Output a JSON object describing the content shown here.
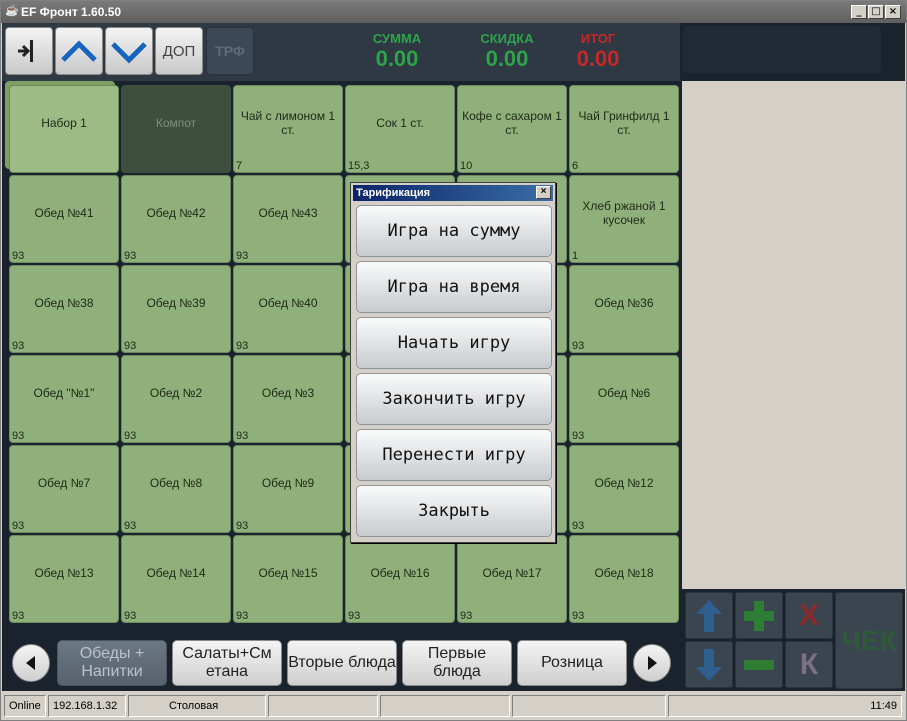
{
  "window": {
    "title": "EF Фронт 1.60.50",
    "controls": [
      "_",
      "□",
      "×"
    ]
  },
  "toolbar": {
    "dop_label": "ДОП",
    "trf_label": "ТРФ",
    "totals": [
      {
        "label": "СУММА",
        "value": "0.00",
        "color": "#2ea34a"
      },
      {
        "label": "СКИДКА",
        "value": "0.00",
        "color": "#2ea34a"
      },
      {
        "label": "ИТОГ",
        "value": "0.00",
        "color": "#c62828"
      }
    ]
  },
  "tiles": [
    [
      "Набор 1",
      ""
    ],
    [
      "Компот",
      ""
    ],
    [
      "Чай с лимоном 1 ст.",
      "7"
    ],
    [
      "Сок 1 ст.",
      "15,3"
    ],
    [
      "Кофе с сахаром 1 ст.",
      "10"
    ],
    [
      "Чай Гринфилд 1 ст.",
      "6"
    ],
    [
      "Обед №41",
      "93"
    ],
    [
      "Обед №42",
      "93"
    ],
    [
      "Обед №43",
      "93"
    ],
    [
      "",
      ""
    ],
    [
      "",
      ""
    ],
    [
      "Хлеб ржаной 1 кусочек",
      "1"
    ],
    [
      "Обед №38",
      "93"
    ],
    [
      "Обед №39",
      "93"
    ],
    [
      "Обед №40",
      "93"
    ],
    [
      "",
      ""
    ],
    [
      "",
      ""
    ],
    [
      "Обед №36",
      "93"
    ],
    [
      "Обед \"№1\"",
      "93"
    ],
    [
      "Обед №2",
      "93"
    ],
    [
      "Обед №3",
      "93"
    ],
    [
      "",
      ""
    ],
    [
      "",
      ""
    ],
    [
      "Обед №6",
      "93"
    ],
    [
      "Обед №7",
      "93"
    ],
    [
      "Обед №8",
      "93"
    ],
    [
      "Обед №9",
      "93"
    ],
    [
      "",
      ""
    ],
    [
      "",
      ""
    ],
    [
      "Обед №12",
      "93"
    ],
    [
      "Обед №13",
      "93"
    ],
    [
      "Обед №14",
      "93"
    ],
    [
      "Обед №15",
      "93"
    ],
    [
      "Обед №16",
      "93"
    ],
    [
      "Обед №17",
      "93"
    ],
    [
      "Обед №18",
      "93"
    ]
  ],
  "categories": [
    "Обеды + Напитки",
    "Салаты+См етана",
    "Вторые блюда",
    "Первые блюда",
    "Розница"
  ],
  "keypad": {
    "check_label": "ЧЕК",
    "x_label": "Х",
    "k_label": "К"
  },
  "status": {
    "online": "Online",
    "ip": "192.168.1.32",
    "place": "Столовая",
    "time": "11:49"
  },
  "dialog": {
    "title": "Тарификация",
    "buttons": [
      "Игра на сумму",
      "Игра на время",
      "Начать игру",
      "Закончить игру",
      "Перенести игру",
      "Закрыть"
    ]
  }
}
